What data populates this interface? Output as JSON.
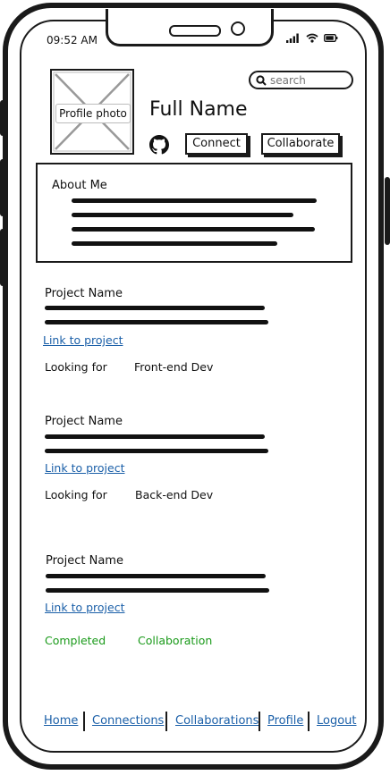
{
  "status": {
    "time": "09:52 AM"
  },
  "search": {
    "placeholder": "search"
  },
  "profile": {
    "photo_label": "Profile photo",
    "name": "Full Name",
    "connect_label": "Connect",
    "collaborate_label": "Collaborate"
  },
  "about": {
    "title": "About Me"
  },
  "projects": [
    {
      "name": "Project Name",
      "link": "Link to project",
      "meta_label": "Looking for",
      "meta_value": "Front-end Dev"
    },
    {
      "name": "Project Name",
      "link": "Link to project",
      "meta_label": "Looking for",
      "meta_value": "Back-end Dev"
    },
    {
      "name": "Project Name",
      "link": "Link to project",
      "meta_label": "Completed",
      "meta_value": "Collaboration"
    }
  ],
  "nav": {
    "items": [
      "Home",
      "Connections",
      "Collaborations",
      "Profile",
      "Logout"
    ]
  },
  "colors": {
    "link": "#1a5fa8",
    "status_green": "#1a9a1a",
    "ink": "#1a1a1a"
  },
  "icons": [
    "github-icon",
    "search-icon",
    "signal-icon",
    "wifi-icon",
    "battery-icon"
  ]
}
